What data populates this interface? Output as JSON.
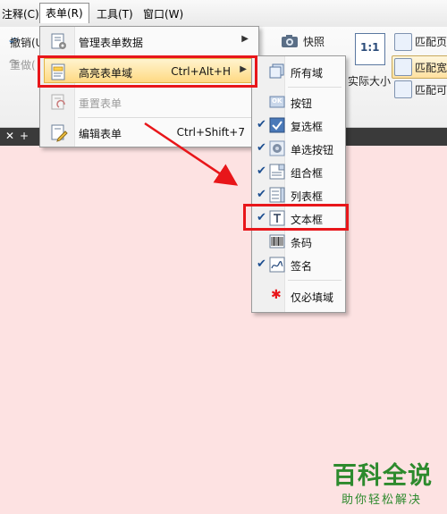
{
  "menubar": {
    "items": [
      "注释(C)",
      "表单(R)",
      "工具(T)",
      "窗口(W)"
    ]
  },
  "ribbon": {
    "left_items": [
      "撤销(U",
      "重做("
    ],
    "snapshot": "快照",
    "actual_size": "实际大小",
    "ratio_label": "1:1",
    "fit_items": [
      "匹配页",
      "匹配宽",
      "匹配可"
    ]
  },
  "form_menu": {
    "items": [
      {
        "label": "管理表单数据",
        "shortcut": "",
        "has_submenu": true,
        "disabled": false
      },
      {
        "label": "高亮表单域",
        "shortcut": "Ctrl+Alt+H",
        "has_submenu": true,
        "disabled": false
      },
      {
        "label": "重置表单",
        "shortcut": "",
        "has_submenu": false,
        "disabled": true
      },
      {
        "label": "编辑表单",
        "shortcut": "Ctrl+Shift+7",
        "has_submenu": false,
        "disabled": false
      }
    ]
  },
  "sub_menu": {
    "items": [
      {
        "label": "所有域",
        "checked": false,
        "icon": "all-fields-icon"
      },
      {
        "label": "按钮",
        "checked": false,
        "icon": "ok-button-icon"
      },
      {
        "label": "复选框",
        "checked": true,
        "icon": "checkbox-icon"
      },
      {
        "label": "单选按钮",
        "checked": true,
        "icon": "radio-button-icon"
      },
      {
        "label": "组合框",
        "checked": true,
        "icon": "combo-box-icon"
      },
      {
        "label": "列表框",
        "checked": true,
        "icon": "list-box-icon"
      },
      {
        "label": "文本框",
        "checked": true,
        "icon": "text-box-icon"
      },
      {
        "label": "条码",
        "checked": false,
        "icon": "barcode-icon"
      },
      {
        "label": "签名",
        "checked": true,
        "icon": "signature-icon"
      },
      {
        "label": "仅必填域",
        "checked": false,
        "icon": "required-star-icon"
      }
    ],
    "ok_icon_text": "OK"
  },
  "watermark": {
    "title": "百科全说",
    "subtitle": "助你轻松解决"
  },
  "colors": {
    "highlight": "#ffd983",
    "annotation_red": "#e8161a",
    "page_background": "#fde2e2",
    "check_blue": "#1d4f91"
  }
}
